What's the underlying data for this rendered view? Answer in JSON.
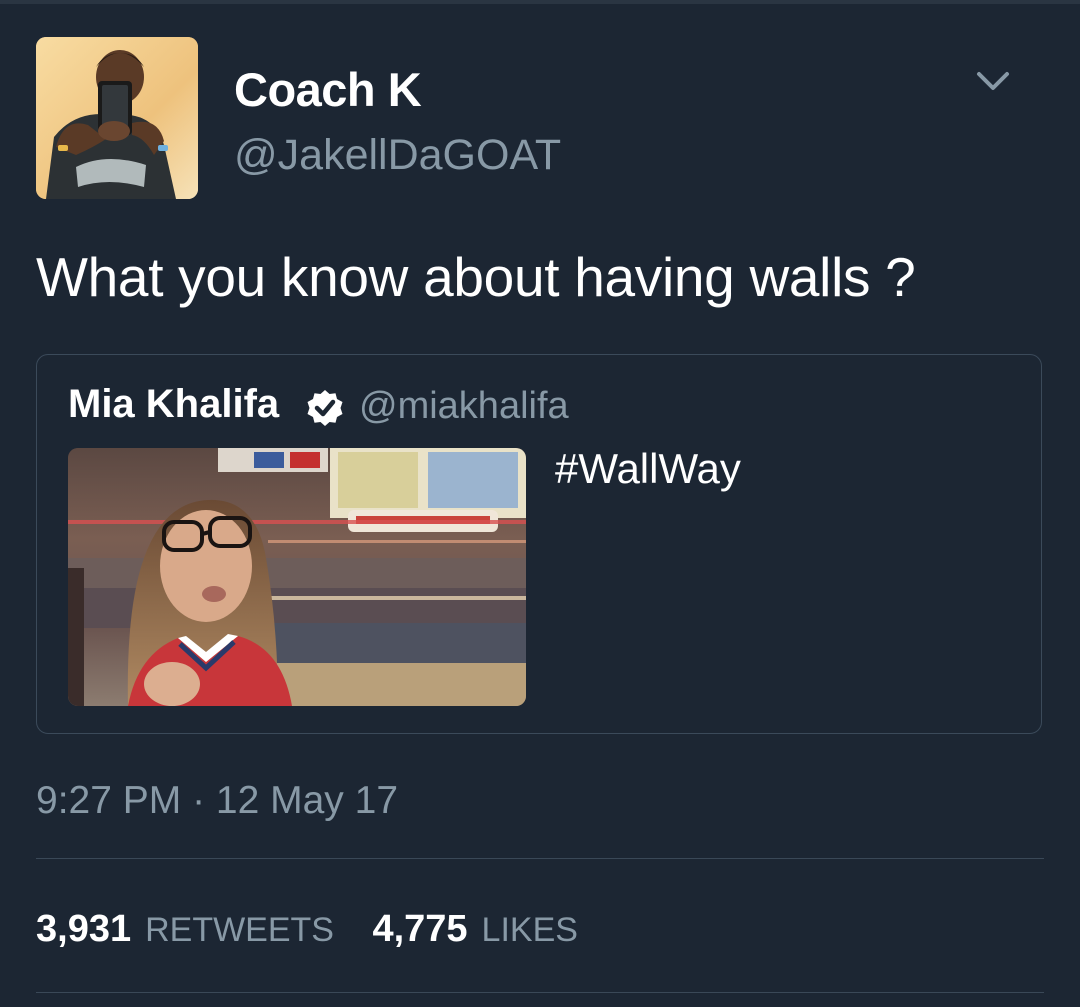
{
  "tweet": {
    "author": {
      "display_name": "Coach K",
      "handle": "@JakellDaGOAT",
      "avatar_icon": "user-avatar-photo"
    },
    "menu_icon": "chevron-down-icon",
    "text": "What you know about having walls ?",
    "quoted": {
      "display_name": "Mia Khalifa",
      "verified_icon": "verified-badge-icon",
      "handle": "@miakhalifa",
      "text": "#WallWay",
      "photo_icon": "attached-photo"
    },
    "timestamp": "9:27 PM · 12 May 17",
    "stats": {
      "retweets_count": "3,931",
      "retweets_label": "RETWEETS",
      "likes_count": "4,775",
      "likes_label": "LIKES"
    }
  },
  "colors": {
    "background": "#1c2633",
    "primary_text": "#ffffff",
    "secondary_text": "#8899a6",
    "border": "#3b4a5a"
  }
}
